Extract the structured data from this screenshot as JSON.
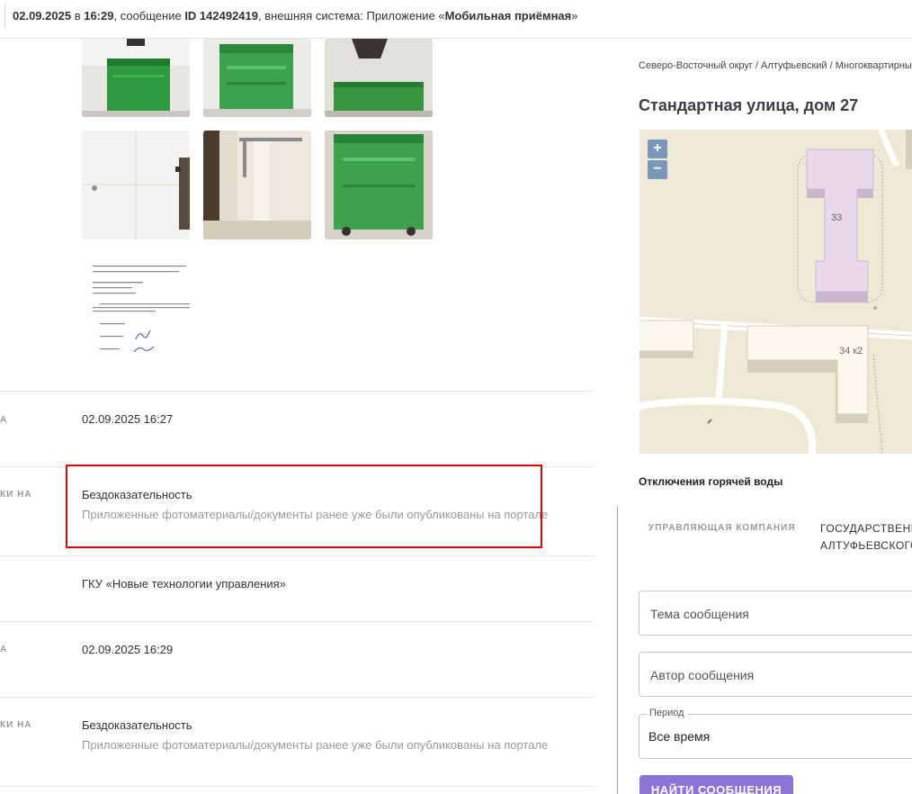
{
  "header": {
    "date": "02.09.2025",
    "sep_v": " в ",
    "time": "16:29",
    "msg_prefix": ", сообщение ",
    "msg_id": "ID 142492419",
    "system_prefix": ", внешняя система: Приложение «",
    "system_name": "Мобильная приёмная",
    "system_suffix": "»"
  },
  "history": [
    {
      "label": "А",
      "value": "02.09.2025 16:27"
    },
    {
      "label": "КИ НА",
      "value": "Бездоказательность",
      "sub": "Приложенные фотоматериалы/документы ранее уже были опубликованы на портале"
    },
    {
      "label": "",
      "value": "ГКУ «Новые технологии управления»"
    },
    {
      "label": "А",
      "value": "02.09.2025 16:29"
    },
    {
      "label": "КИ НА",
      "value": "Бездоказательность",
      "sub": "Приложенные фотоматериалы/документы ранее уже были опубликованы на портале"
    }
  ],
  "sidebar": {
    "breadcrumb": "Северо-Восточный округ / Алтуфьевский / Многоквартирный дом",
    "address": "Стандартная улица, дом 27",
    "map": {
      "zoom_in": "+",
      "zoom_out": "−",
      "building_a": "33",
      "building_b": "34 к2"
    },
    "hot_water": "Отключения горячей воды",
    "mc_label": "УПРАВЛЯЮЩАЯ КОМПАНИЯ",
    "mc_value_1": "ГОСУДАРСТВЕННОЕ",
    "mc_value_2": "АЛТУФЬЕВСКОГО РАЙОНА",
    "topic_placeholder": "Тема сообщения",
    "author_placeholder": "Автор сообщения",
    "period_legend": "Период",
    "period_value": "Все время",
    "find_button": "НАЙТИ СООБЩЕНИЯ"
  },
  "colors": {
    "accent": "#8a74d6",
    "highlight": "#d7090d",
    "map_bg": "#eee9d5",
    "building": "#e8d8ea"
  }
}
